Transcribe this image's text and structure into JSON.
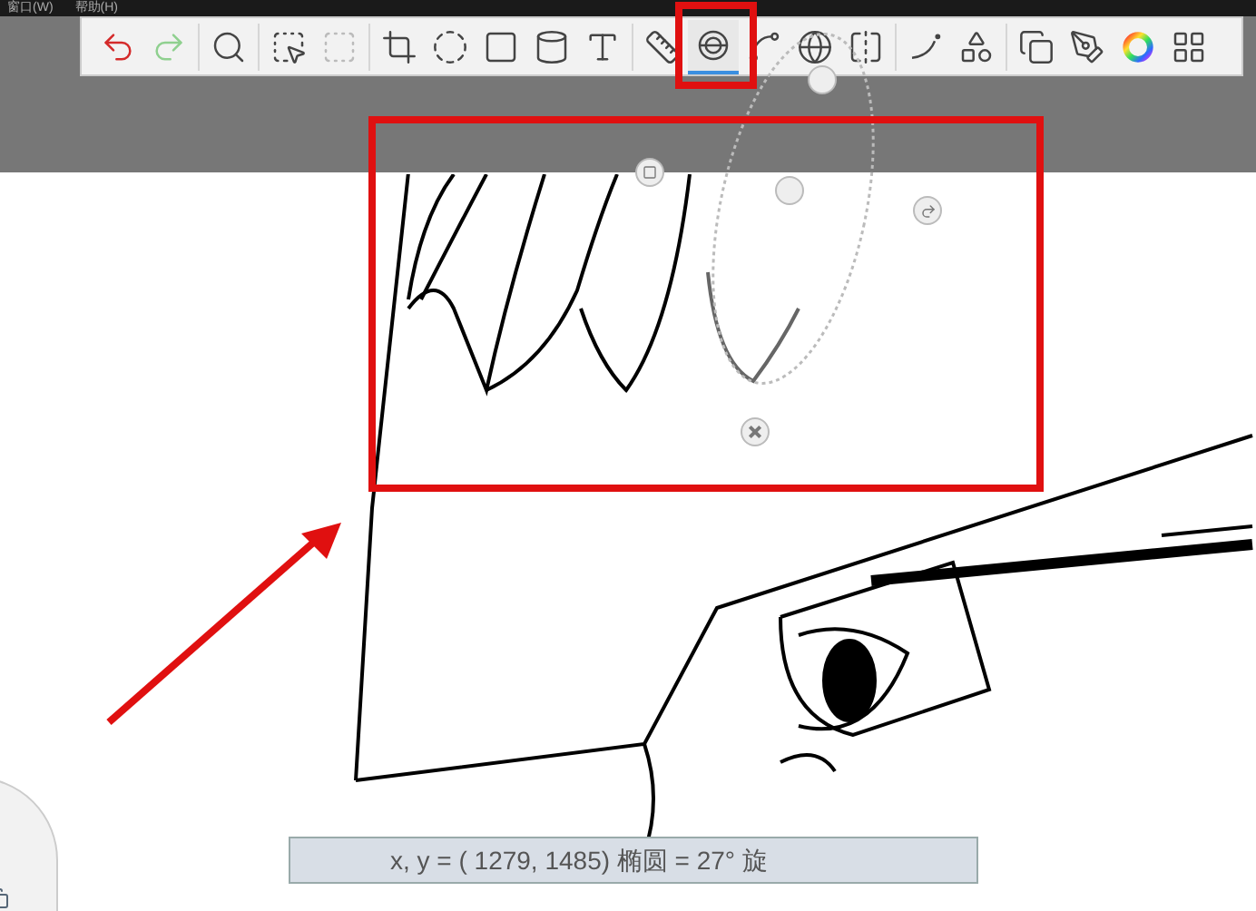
{
  "menu": [
    {
      "label": "窗口(W)"
    },
    {
      "label": "帮助(H)"
    }
  ],
  "toolbar": {
    "tools": [
      {
        "kind": "undo",
        "selected": false
      },
      {
        "kind": "redo",
        "selected": false
      },
      {
        "kind": "zoom",
        "selected": false
      },
      {
        "kind": "select",
        "selected": false
      },
      {
        "kind": "deselect",
        "selected": false
      },
      {
        "kind": "crop",
        "selected": false
      },
      {
        "kind": "lasso",
        "selected": false
      },
      {
        "kind": "distort",
        "selected": false
      },
      {
        "kind": "cylinder",
        "selected": false
      },
      {
        "kind": "text",
        "selected": false
      },
      {
        "kind": "ruler",
        "selected": false
      },
      {
        "kind": "ellipse",
        "selected": true
      },
      {
        "kind": "curve",
        "selected": false
      },
      {
        "kind": "perspective",
        "selected": false
      },
      {
        "kind": "symmetry",
        "selected": false
      },
      {
        "kind": "stroke",
        "selected": false
      },
      {
        "kind": "shapes",
        "selected": false
      },
      {
        "kind": "copy",
        "selected": false
      },
      {
        "kind": "brushes",
        "selected": false
      },
      {
        "kind": "color",
        "selected": false
      },
      {
        "kind": "palette",
        "selected": false
      }
    ]
  },
  "status_bar": {
    "text": "x, y = ( 1279,  1485) 椭圆 =  27° 旋"
  }
}
